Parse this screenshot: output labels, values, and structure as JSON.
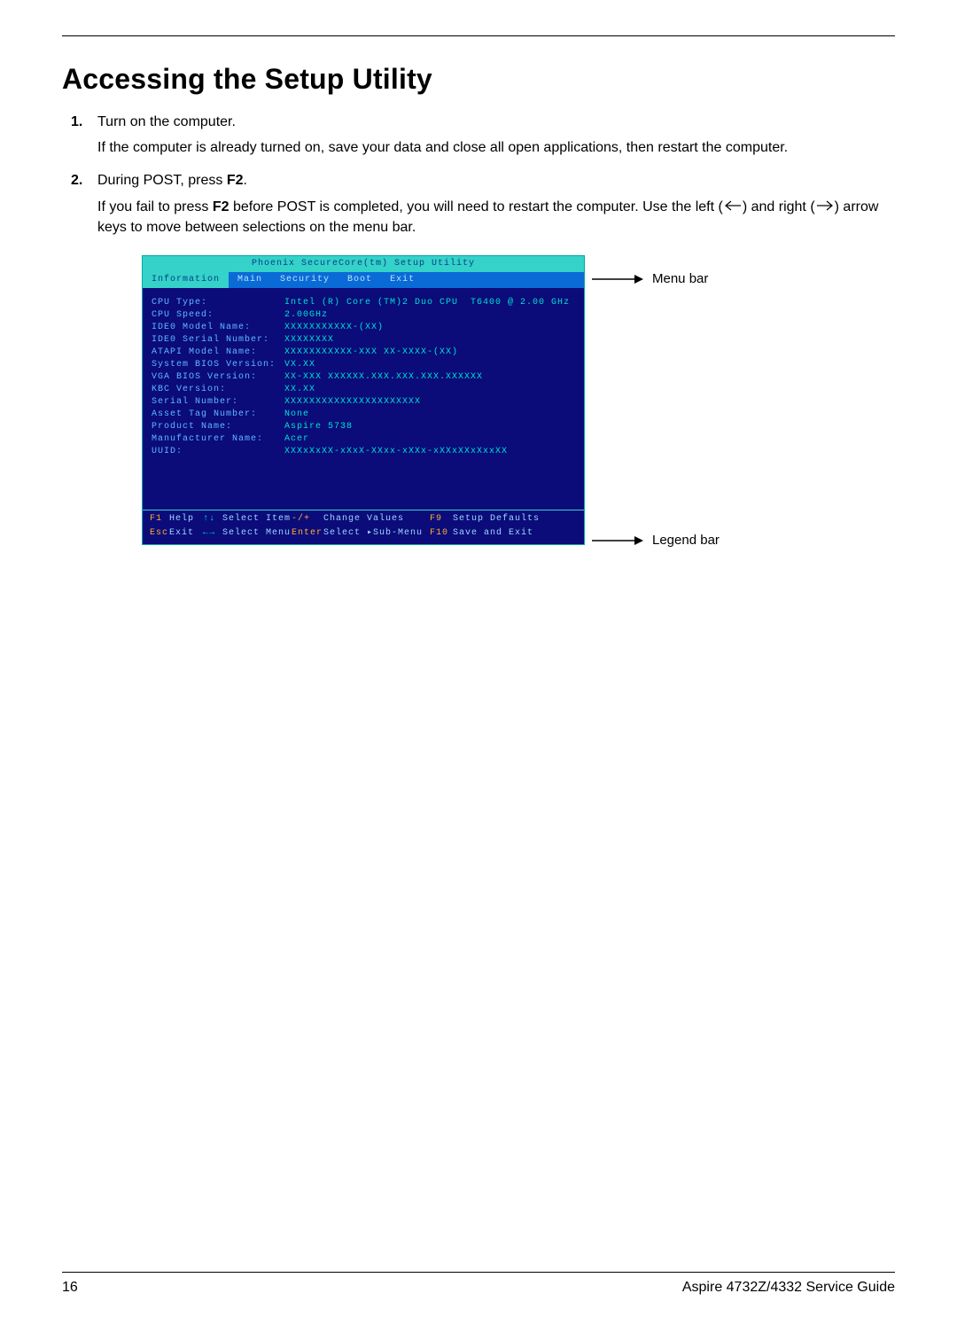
{
  "page": {
    "title": "Accessing the Setup Utility",
    "number": "16",
    "footer_right": "Aspire 4732Z/4332 Service Guide"
  },
  "steps": {
    "s1_lead": "Turn on the computer.",
    "s1_body": "If the computer is already turned on, save your data and close all open applications, then restart the computer.",
    "s2_lead_a": "During POST, press ",
    "s2_lead_b": "F2",
    "s2_lead_c": ".",
    "s2_body_a": "If you fail to press ",
    "s2_body_b": "F2",
    "s2_body_c": " before POST is completed, you will need to restart the computer. Use the left (",
    "s2_body_d": ") and right (",
    "s2_body_e": ") arrow keys to move between selections on the menu bar."
  },
  "annotations": {
    "menu_bar": "Menu bar",
    "legend_bar": "Legend bar"
  },
  "bios": {
    "title": "Phoenix SecureCore(tm) Setup Utility",
    "menu": {
      "information": "Information",
      "main": "Main",
      "security": "Security",
      "boot": "Boot",
      "exit": "Exit"
    },
    "fields": [
      {
        "label": "CPU Type:",
        "value": "Intel (R) Core (TM)2 Duo CPU  T6400 @ 2.00 GHz"
      },
      {
        "label": "CPU Speed:",
        "value": "2.00GHz"
      },
      {
        "label": "IDE0 Model Name:",
        "value": "XXXXXXXXXXX-(XX)"
      },
      {
        "label": "IDE0 Serial Number:",
        "value": "XXXXXXXX"
      },
      {
        "label": "ATAPI Model Name:",
        "value": "XXXXXXXXXXX-XXX XX-XXXX-(XX)"
      },
      {
        "label": "System BIOS Version:",
        "value": "VX.XX"
      },
      {
        "label": "VGA BIOS Version:",
        "value": "XX-XXX XXXXXX.XXX.XXX.XXX.XXXXXX"
      },
      {
        "label": "KBC Version:",
        "value": "XX.XX"
      },
      {
        "label": "Serial Number:",
        "value": "XXXXXXXXXXXXXXXXXXXXXX"
      },
      {
        "label": "Asset Tag Number:",
        "value": "None"
      },
      {
        "label": "Product Name:",
        "value": "Aspire 5738"
      },
      {
        "label": "Manufacturer Name:",
        "value": "Acer"
      },
      {
        "label": "UUID:",
        "value": "XXXxXxXX-xXxX-XXxx-xXXx-xXXxXXxXxxXX"
      }
    ],
    "legend": {
      "f1": "F1",
      "f1_label": "Help",
      "updown": "↑↓",
      "updown_label": "Select Item",
      "minplus": "-/+",
      "minplus_label": "Change Values",
      "f9": "F9",
      "f9_label": "Setup Defaults",
      "esc": "Esc",
      "esc_label": "Exit",
      "leftright": "←→",
      "leftright_label": "Select Menu",
      "enter": "Enter",
      "enter_label": "Select ▸Sub-Menu",
      "f10": "F10",
      "f10_label": "Save and Exit"
    }
  }
}
